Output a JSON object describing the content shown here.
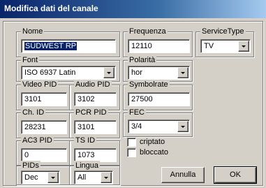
{
  "window": {
    "title": "Modifica dati del canale"
  },
  "nome": {
    "label": "Nome",
    "value": "SÜDWEST RP"
  },
  "frequenza": {
    "label": "Frequenza",
    "value": "12110"
  },
  "service_type": {
    "label": "ServiceType",
    "value": "TV"
  },
  "font": {
    "label": "Font",
    "value": "ISO 6937 Latin"
  },
  "polarita": {
    "label": "Polarità",
    "value": "hor"
  },
  "video_pid": {
    "label": "Video PID",
    "value": "3101"
  },
  "audio_pid": {
    "label": "Audio PID",
    "value": "3102"
  },
  "symbolrate": {
    "label": "Symbolrate",
    "value": "27500"
  },
  "ch_id": {
    "label": "Ch. ID",
    "value": "28231"
  },
  "pcr_pid": {
    "label": "PCR PID",
    "value": "3101"
  },
  "fec": {
    "label": "FEC",
    "value": "3/4"
  },
  "ac3_pid": {
    "label": "AC3 PID",
    "value": "0"
  },
  "ts_id": {
    "label": "TS ID",
    "value": "1073"
  },
  "criptato": {
    "label": "criptato",
    "checked": false
  },
  "bloccato": {
    "label": "bloccato",
    "checked": false
  },
  "pids": {
    "label": "PIDs",
    "value": "Dec"
  },
  "lingua": {
    "label": "Lingua",
    "value": "All"
  },
  "buttons": {
    "cancel": "Annulla",
    "ok": "OK"
  }
}
